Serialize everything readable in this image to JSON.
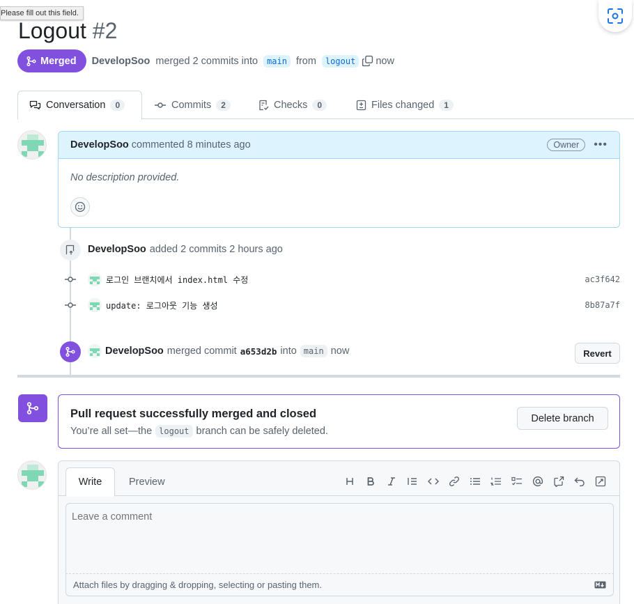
{
  "tooltip": "Please fill out this field.",
  "pr": {
    "title": "Logout",
    "number": "#2",
    "state_label": "Merged",
    "author": "DevelopSoo",
    "merged_text": "merged 2 commits into",
    "base_branch": "main",
    "from_text": "from",
    "head_branch": "logout",
    "time": "now"
  },
  "tabs": [
    {
      "label": "Conversation",
      "count": "0"
    },
    {
      "label": "Commits",
      "count": "2"
    },
    {
      "label": "Checks",
      "count": "0"
    },
    {
      "label": "Files changed",
      "count": "1"
    }
  ],
  "comment": {
    "author": "DevelopSoo",
    "action": "commented 8 minutes ago",
    "role": "Owner",
    "body": "No description provided."
  },
  "commits_event": {
    "author": "DevelopSoo",
    "text": "added 2 commits 2 hours ago",
    "commits": [
      {
        "message": "로그인 브랜치에서 index.html 수정",
        "sha": "ac3f642"
      },
      {
        "message": "update: 로그아웃 기능 생성",
        "sha": "8b87a7f"
      }
    ]
  },
  "merge_event": {
    "author": "DevelopSoo",
    "text": "merged commit",
    "sha": "a653d2b",
    "into": "into",
    "branch": "main",
    "time": "now",
    "revert_label": "Revert"
  },
  "merge_box": {
    "title": "Pull request successfully merged and closed",
    "sub_before": "You’re all set—the",
    "branch": "logout",
    "sub_after": "branch can be safely deleted.",
    "delete_label": "Delete branch"
  },
  "editor": {
    "write_label": "Write",
    "preview_label": "Preview",
    "placeholder": "Leave a comment",
    "attach_text": "Attach files by dragging & dropping, selecting or pasting them."
  },
  "colors": {
    "merged": "#8250df",
    "comment_header": "#ddf4ff",
    "link": "#0969da"
  }
}
